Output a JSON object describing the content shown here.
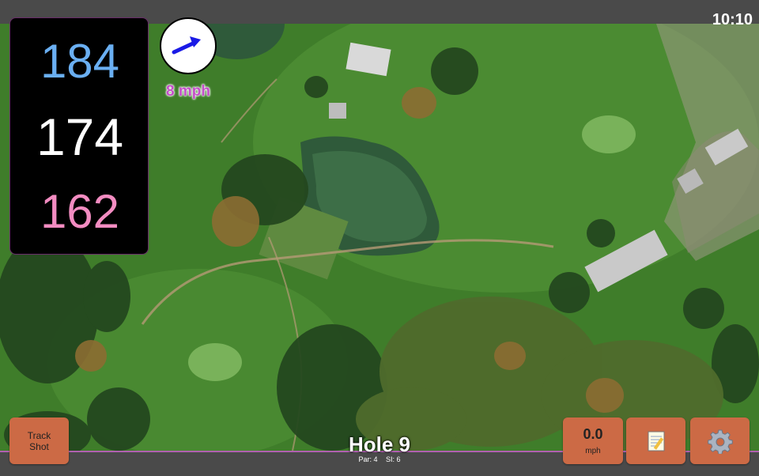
{
  "status": {
    "time": "10:10"
  },
  "distances": {
    "back": "184",
    "middle": "174",
    "front": "162",
    "colors": {
      "back": "#6aaff2",
      "middle": "#ffffff",
      "front": "#f28cc1"
    }
  },
  "wind": {
    "speed": "8 mph",
    "icon": "wind-arrow-icon",
    "arrow_color": "#1a1ae6"
  },
  "buttons": {
    "track_shot": "Track Shot",
    "speed_value": "0.0",
    "speed_unit": "mph",
    "notes_icon": "notepad-icon",
    "settings_icon": "gear-icon"
  },
  "hole": {
    "title": "Hole 9",
    "par": "Par: 4",
    "si": "SI: 6"
  },
  "colors": {
    "button_bg": "#cc6a45",
    "bar_bg": "#4a4a4a",
    "accent": "#b060b0"
  }
}
